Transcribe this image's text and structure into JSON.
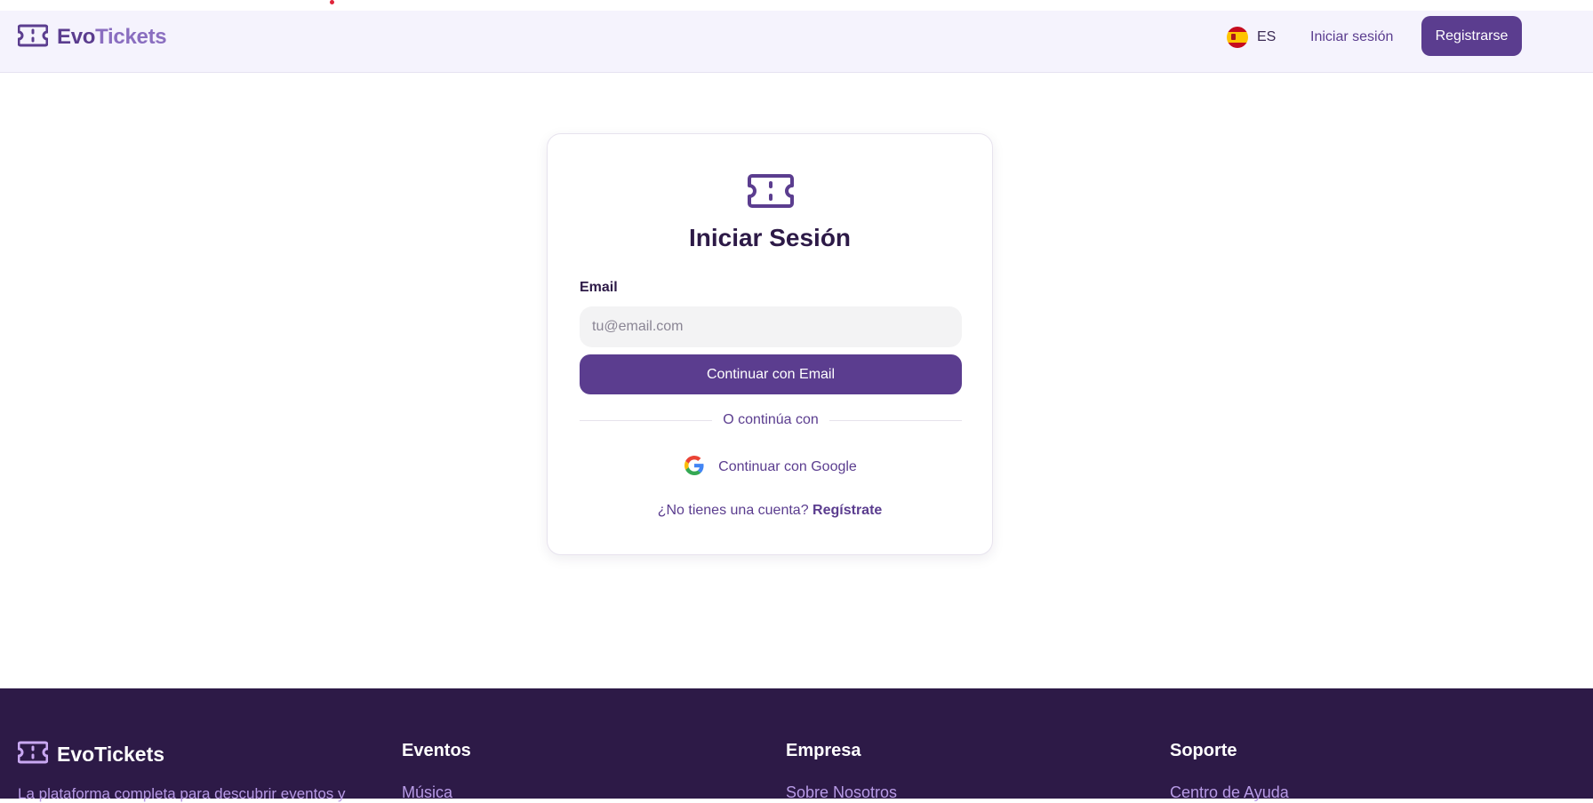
{
  "brand": {
    "name_part1": "Evo",
    "name_part2": "Tickets"
  },
  "nav": {
    "language": "ES",
    "login_label": "Iniciar sesión",
    "register_label": "Registrarse"
  },
  "login_card": {
    "title": "Iniciar Sesión",
    "email_label": "Email",
    "email_placeholder": "tu@email.com",
    "email_value": "",
    "email_button": "Continuar con Email",
    "divider_text": "O continúa con",
    "google_button": "Continuar con Google",
    "no_account_text": "¿No tienes una cuenta?",
    "signup_link": "Regístrate"
  },
  "footer": {
    "brand_name": "EvoTickets",
    "description": "La plataforma completa para descubrir eventos y",
    "columns": [
      {
        "title": "Eventos",
        "first_link": "Música"
      },
      {
        "title": "Empresa",
        "first_link": "Sobre Nosotros"
      },
      {
        "title": "Soporte",
        "first_link": "Centro de Ayuda"
      }
    ]
  },
  "colors": {
    "primary": "#5b3d8f",
    "dark": "#2d1a47",
    "nav_bg": "#f5f3fd",
    "footer_link": "#b89be6"
  },
  "icons": {
    "brand": "ticket-icon",
    "flag": "spain-flag-icon",
    "google": "google-logo-icon"
  }
}
